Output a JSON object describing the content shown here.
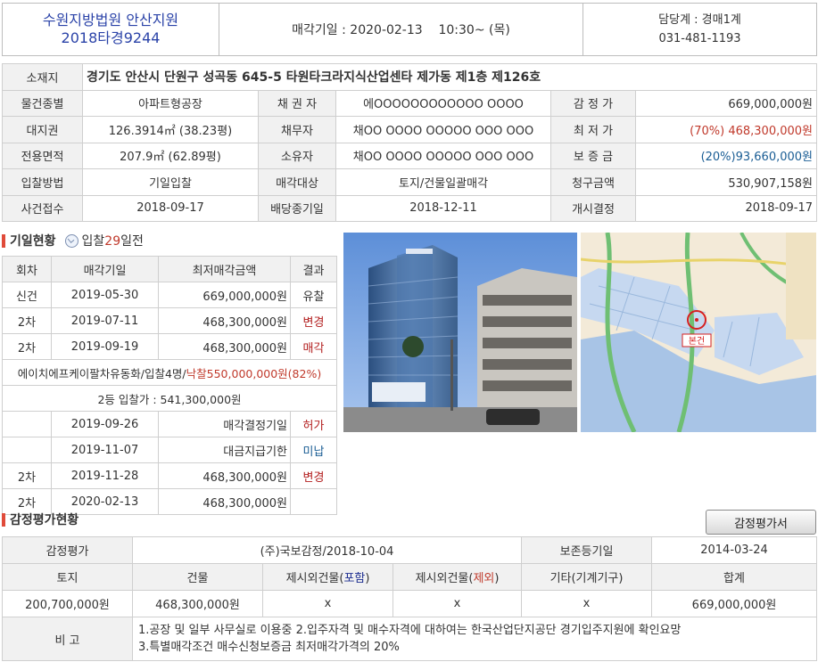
{
  "header": {
    "court": "수원지방법원 안산지원",
    "case_no": "2018타경9244",
    "sale_date_label": "매각기일 : 2020-02-13",
    "sale_time": "10:30~ (목)",
    "dept": "담당계 : 경매1계",
    "phone": "031-481-1193"
  },
  "info": {
    "address_label": "소재지",
    "address": "경기도 안산시 단원구 성곡동 645-5 타원타크라지식산업센타 제가동 제1층 제126호",
    "rows": [
      {
        "l1": "물건종별",
        "v1": "아파트형공장",
        "l2": "채 권 자",
        "v2": "에OOOOOOOOOOOO OOOO",
        "l3": "감 정 가",
        "v3": "669,000,000원",
        "pre": "",
        "preColor": ""
      },
      {
        "l1": "대지권",
        "v1": "126.3914㎡ (38.23평)",
        "l2": "채무자",
        "v2": "채OO OOOO OOOOO OOO OOO",
        "l3": "최 저 가",
        "v3": "468,300,000원",
        "pre": "(70%) ",
        "preColor": "red"
      },
      {
        "l1": "전용면적",
        "v1": "207.9㎡ (62.89평)",
        "l2": "소유자",
        "v2": "채OO OOOO OOOOO OOO OOO",
        "l3": "보 증 금",
        "v3": "93,660,000원",
        "pre": "(20%)",
        "preColor": "blue"
      },
      {
        "l1": "입찰방법",
        "v1": "기일입찰",
        "l2": "매각대상",
        "v2": "토지/건물일괄매각",
        "l3": "청구금액",
        "v3": "530,907,158원",
        "pre": "",
        "preColor": ""
      },
      {
        "l1": "사건접수",
        "v1": "2018-09-17",
        "l2": "배당종기일",
        "v2": "2018-12-11",
        "l3": "개시결정",
        "v3": "2018-09-17",
        "pre": "",
        "preColor": ""
      }
    ]
  },
  "schedule": {
    "title": "기일현황",
    "days_prefix": "입찰",
    "days_num": "29",
    "days_suffix": "일전",
    "headers": [
      "회차",
      "매각기일",
      "최저매각금액",
      "결과"
    ],
    "rows_a": [
      {
        "round": "신건",
        "date": "2019-05-30",
        "amount": "669,000,000원",
        "result": "유찰",
        "rc": "plain"
      },
      {
        "round": "2차",
        "date": "2019-07-11",
        "amount": "468,300,000원",
        "result": "변경",
        "rc": "red"
      },
      {
        "round": "2차",
        "date": "2019-09-19",
        "amount": "468,300,000원",
        "result": "매각",
        "rc": "red"
      }
    ],
    "winner_name": "에이치에프케이팔차유동화/입찰4명/",
    "winner_price": "낙찰550,000,000원(82%)",
    "second_bid": "2등 입찰가 : 541,300,000원",
    "rows_b": [
      {
        "round": "",
        "date": "2019-09-26",
        "amount": "매각결정기일",
        "result": "허가",
        "rc": "red"
      },
      {
        "round": "",
        "date": "2019-11-07",
        "amount": "대금지급기한",
        "result": "미납",
        "rc": "blue"
      },
      {
        "round": "2차",
        "date": "2019-11-28",
        "amount": "468,300,000원",
        "result": "변경",
        "rc": "red"
      },
      {
        "round": "2차",
        "date": "2020-02-13",
        "amount": "468,300,000원",
        "result": "",
        "rc": "plain"
      }
    ]
  },
  "map": {
    "marker_label": "본건"
  },
  "appraisal": {
    "title": "감정평가현황",
    "button": "감정평가서",
    "org_label": "감정평가",
    "org": "(주)국보감정/2018-10-04",
    "reg_label": "보존등기일",
    "reg": "2014-03-24",
    "h_land": "토지",
    "h_bldg": "건물",
    "h_ex1_pre": "제시외건물(",
    "h_ex1_mid": "포함",
    "h_ex1_post": ")",
    "h_ex2_pre": "제시외건물(",
    "h_ex2_mid": "제외",
    "h_ex2_post": ")",
    "h_etc": "기타(기계기구)",
    "h_total": "합계",
    "land": "200,700,000원",
    "bldg": "468,300,000원",
    "ex1": "x",
    "ex2": "x",
    "etc": "x",
    "total": "669,000,000원",
    "note_label": "비 고",
    "note1": "1.공장 및 일부 사무실로 이용중 2.입주자격 및 매수자격에 대하여는 한국산업단지공단 경기입주지원에 확인요망",
    "note2": "3.특별매각조건 매수신청보증금 최저매각가격의 20%"
  }
}
